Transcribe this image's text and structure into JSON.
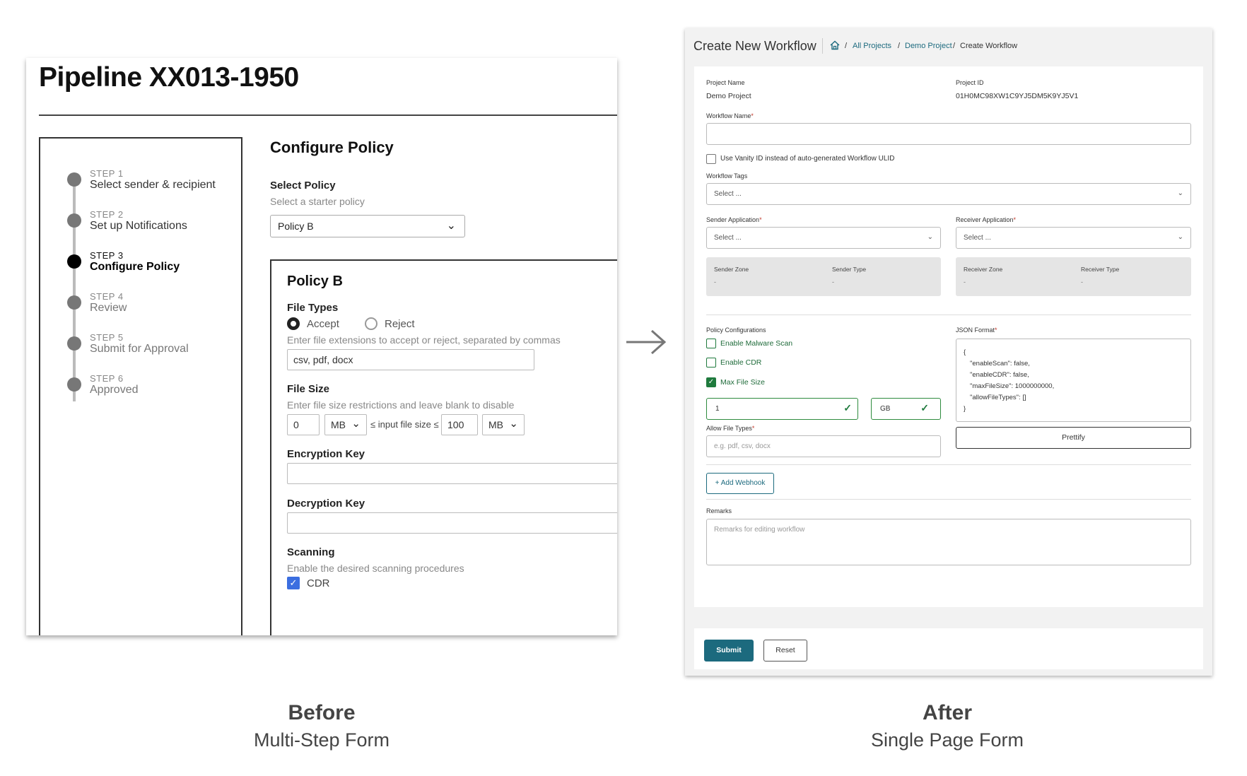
{
  "before": {
    "page_title": "Pipeline XX013-1950",
    "steps": [
      {
        "num": "STEP 1",
        "label": "Select sender & recipient"
      },
      {
        "num": "STEP 2",
        "label": "Set up Notifications"
      },
      {
        "num": "STEP 3",
        "label": "Configure Policy"
      },
      {
        "num": "STEP 4",
        "label": "Review"
      },
      {
        "num": "STEP 5",
        "label": "Submit for Approval"
      },
      {
        "num": "STEP 6",
        "label": "Approved"
      }
    ],
    "section_title": "Configure Policy",
    "select_policy_label": "Select Policy",
    "select_policy_help": "Select a starter policy",
    "select_policy_value": "Policy B",
    "policy": {
      "title": "Policy B",
      "file_types_label": "File Types",
      "accept_label": "Accept",
      "reject_label": "Reject",
      "file_types_help": "Enter file extensions to accept or reject, separated by commas",
      "file_types_value": "csv, pdf, docx",
      "file_size_label": "File Size",
      "file_size_help": "Enter file size restrictions and leave blank to disable",
      "min_value": "0",
      "min_unit": "MB",
      "range_text": "≤ input file size ≤",
      "max_value": "100",
      "max_unit": "MB",
      "encryption_key_label": "Encryption Key",
      "decryption_key_label": "Decryption Key",
      "scanning_label": "Scanning",
      "scanning_help": "Enable the desired scanning procedures",
      "cdr_label": "CDR"
    }
  },
  "after": {
    "title": "Create New Workflow",
    "breadcrumb": [
      "All Projects",
      "Demo Project",
      "Create Workflow"
    ],
    "project_name_label": "Project Name",
    "project_name_value": "Demo Project",
    "project_id_label": "Project ID",
    "project_id_value": "01H0MC98XW1C9YJ5DM5K9YJ5V1",
    "workflow_name_label": "Workflow Name",
    "vanity_label": "Use Vanity ID instead of auto-generated Workflow ULID",
    "workflow_tags_label": "Workflow Tags",
    "workflow_tags_placeholder": "Select ...",
    "sender_app_label": "Sender Application",
    "sender_app_placeholder": "Select ...",
    "receiver_app_label": "Receiver Application",
    "receiver_app_placeholder": "Select ...",
    "sender_zone_label": "Sender Zone",
    "sender_zone_value": "-",
    "sender_type_label": "Sender Type",
    "sender_type_value": "-",
    "receiver_zone_label": "Receiver Zone",
    "receiver_zone_value": "-",
    "receiver_type_label": "Receiver Type",
    "receiver_type_value": "-",
    "policy_config_label": "Policy Configurations",
    "malware_label": "Enable Malware Scan",
    "cdr_label": "Enable CDR",
    "max_size_label": "Max File Size",
    "max_size_value": "1",
    "max_size_unit": "GB",
    "allow_types_label": "Allow File Types",
    "allow_types_placeholder": "e.g. pdf, csv, docx",
    "json_label": "JSON Format",
    "json_lines": [
      "{",
      "\"enableScan\": false,",
      "\"enableCDR\": false,",
      "\"maxFileSize\": 1000000000,",
      "\"allowFileTypes\": []",
      "}"
    ],
    "prettify_label": "Prettify",
    "add_webhook_label": "+ Add Webhook",
    "remarks_label": "Remarks",
    "remarks_placeholder": "Remarks for editing workflow",
    "submit_label": "Submit",
    "reset_label": "Reset",
    "required_mark": "*"
  },
  "captions": {
    "before_title": "Before",
    "before_sub": "Multi-Step Form",
    "after_title": "After",
    "after_sub": "Single Page Form"
  },
  "colors": {
    "teal": "#1c6a7e",
    "green": "#1f7a3d",
    "required": "#c0392b"
  }
}
